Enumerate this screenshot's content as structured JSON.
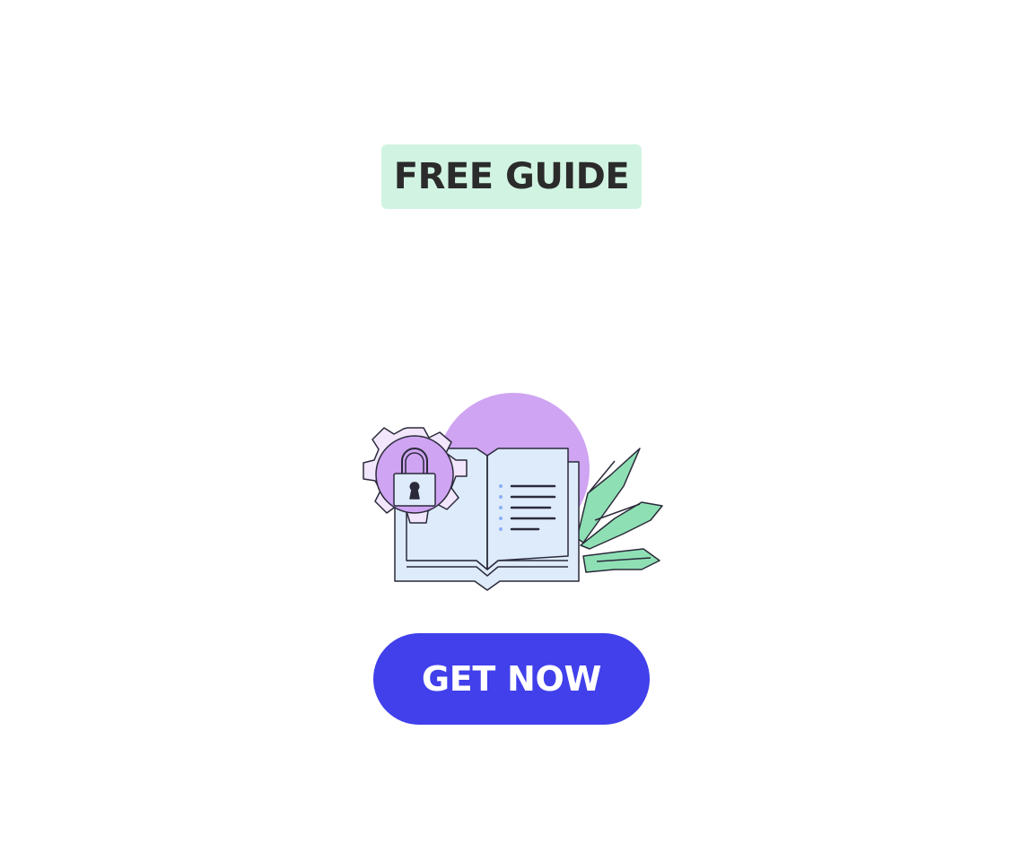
{
  "badge": {
    "label": "FREE GUIDE"
  },
  "illustration": {
    "name": "open-book-with-security-lock-gear",
    "colors": {
      "circle": "#cfa4f2",
      "book_page": "#deebfb",
      "gear_fill": "#f2e6fc",
      "gear_inner": "#cfa4f2",
      "leaves": "#8ee0b4",
      "outline": "#2a2a3a",
      "bullets": "#8ab0f5"
    }
  },
  "cta": {
    "label": "GET NOW",
    "color": "#4140eb"
  }
}
